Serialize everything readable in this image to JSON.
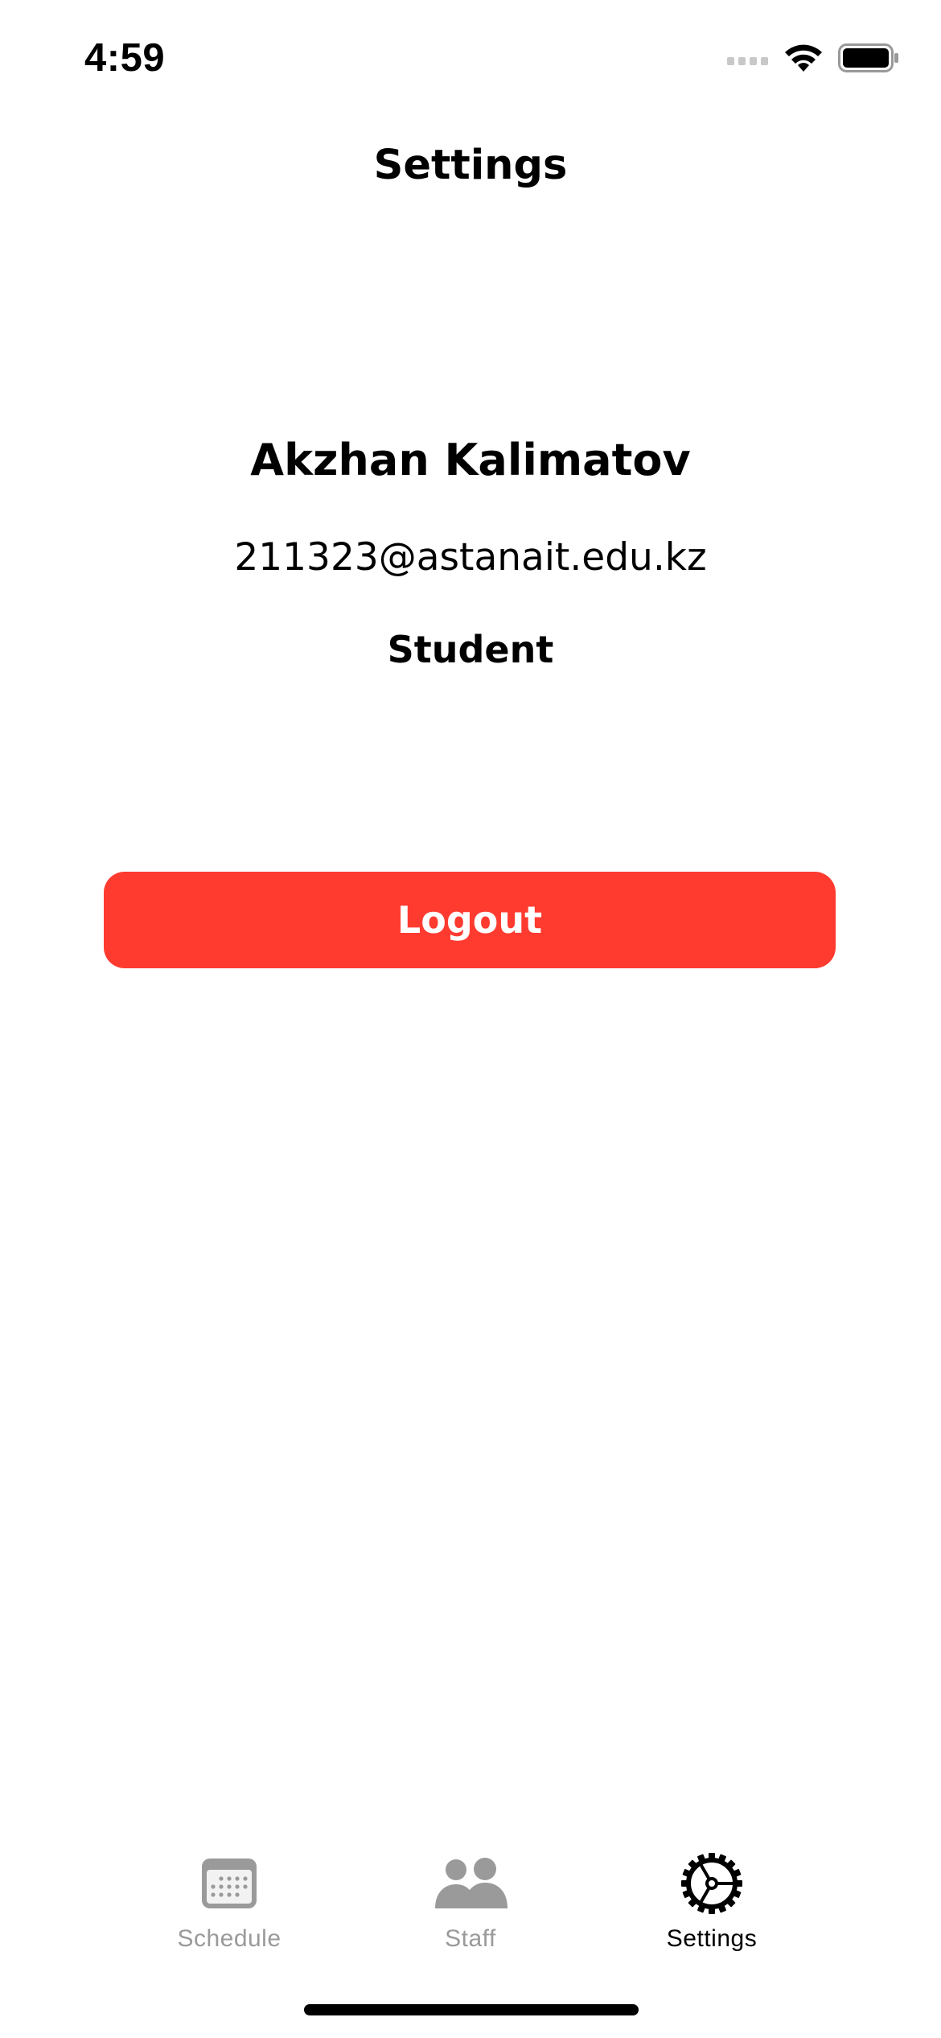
{
  "status_bar": {
    "time": "4:59",
    "icons": [
      "cellular-signal-icon",
      "wifi-icon",
      "battery-icon"
    ]
  },
  "nav": {
    "title": "Settings"
  },
  "profile": {
    "name": "Akzhan Kalimatov",
    "email": "211323@astanait.edu.kz",
    "role": "Student"
  },
  "actions": {
    "logout_label": "Logout"
  },
  "tab_bar": {
    "items": [
      {
        "label": "Schedule",
        "icon": "calendar-icon",
        "active": false
      },
      {
        "label": "Staff",
        "icon": "people-icon",
        "active": false
      },
      {
        "label": "Settings",
        "icon": "gear-icon",
        "active": true
      }
    ]
  },
  "colors": {
    "accent_red": "#ff3b30",
    "tab_inactive": "#9a9a9a",
    "tab_active": "#000000",
    "background": "#ffffff"
  }
}
